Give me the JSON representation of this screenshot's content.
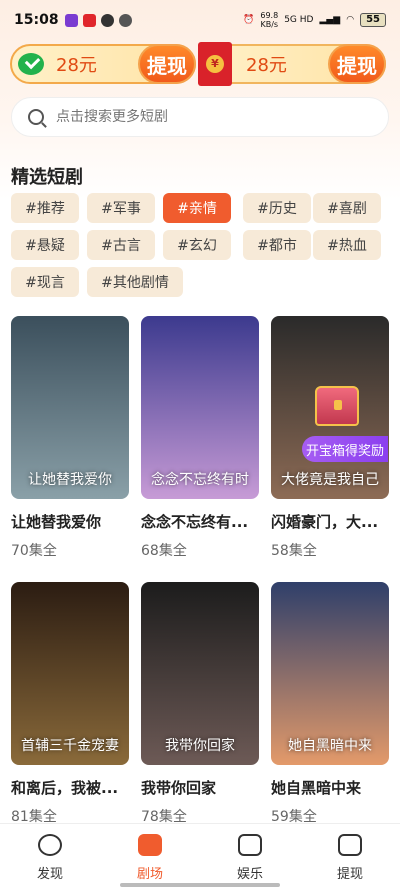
{
  "status_bar": {
    "time": "15:08",
    "net_speed": "69.8",
    "net_unit": "KB/s",
    "network": "5G HD",
    "battery": "55"
  },
  "rewards": [
    {
      "amount": "28元",
      "button": "提现",
      "icon": "wechat-icon"
    },
    {
      "amount": "28元",
      "button": "提现",
      "icon": "red-packet-icon"
    }
  ],
  "search": {
    "placeholder": "点击搜索更多短剧"
  },
  "section_title": "精选短剧",
  "tags": [
    {
      "label": "#推荐",
      "active": false
    },
    {
      "label": "#军事",
      "active": false
    },
    {
      "label": "#亲情",
      "active": true
    },
    {
      "label": "#历史",
      "active": false
    },
    {
      "label": "#喜剧",
      "active": false
    },
    {
      "label": "#悬疑",
      "active": false
    },
    {
      "label": "#古言",
      "active": false
    },
    {
      "label": "#玄幻",
      "active": false
    },
    {
      "label": "#都市",
      "active": false
    },
    {
      "label": "#热血",
      "active": false
    },
    {
      "label": "#现言",
      "active": false
    },
    {
      "label": "#其他剧情",
      "active": false
    }
  ],
  "dramas": [
    {
      "title": "让她替我爱你",
      "episodes": "70集全",
      "poster_text": "让她替我爱你",
      "color1": "#3b4f5c",
      "color2": "#8aa0a8"
    },
    {
      "title": "念念不忘终有...",
      "episodes": "68集全",
      "poster_text": "念念不忘终有时",
      "color1": "#3c3a8e",
      "color2": "#c79bd6"
    },
    {
      "title": "闪婚豪门，大...",
      "episodes": "58集全",
      "poster_text": "大佬竟是我自己",
      "color1": "#2a2a2a",
      "color2": "#8d6b55"
    },
    {
      "title": "和离后，我被...",
      "episodes": "81集全",
      "poster_text": "首辅三千金宠妻",
      "color1": "#2b1c12",
      "color2": "#8a6a3a"
    },
    {
      "title": "我带你回家",
      "episodes": "78集全",
      "poster_text": "我带你回家",
      "color1": "#1c1c1c",
      "color2": "#6d5a56"
    },
    {
      "title": "她自黑暗中来",
      "episodes": "59集全",
      "poster_text": "她自黑暗中来",
      "color1": "#2f3f6a",
      "color2": "#e39a6a"
    }
  ],
  "chest_badge": "开宝箱得奖励",
  "nav": [
    {
      "label": "发现",
      "icon": "discover-icon",
      "active": false
    },
    {
      "label": "剧场",
      "icon": "theater-icon",
      "active": true
    },
    {
      "label": "娱乐",
      "icon": "entertainment-icon",
      "active": false
    },
    {
      "label": "提现",
      "icon": "withdraw-icon",
      "active": false
    }
  ],
  "colors": {
    "accent": "#f05c2e",
    "tag_bg": "#f7ead8"
  }
}
